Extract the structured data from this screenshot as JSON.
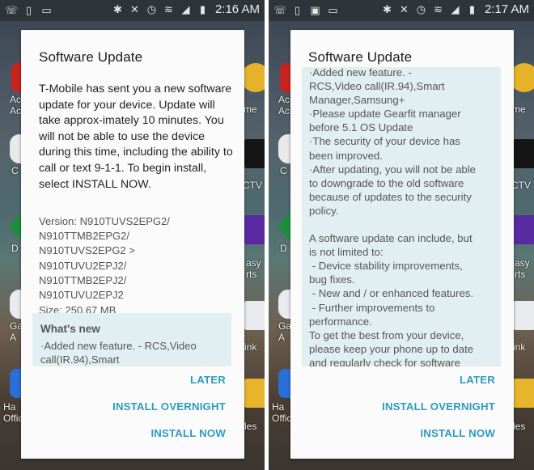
{
  "screens": [
    {
      "status_bar": {
        "time": "2:16 AM",
        "left_icons": [
          "wifi-calling-icon",
          "device-update-icon",
          "voicemail-icon"
        ],
        "right_icons": [
          "bluetooth-icon",
          "mute-icon",
          "alarm-icon",
          "wifi-icon",
          "signal-icon",
          "battery-charging-icon"
        ]
      },
      "background_apps_left": [
        {
          "label": "Ac\nAc",
          "color": "#c8231f"
        },
        {
          "label": "C",
          "color": "#e9e9e9"
        },
        {
          "label": "D",
          "color": "#1e8e3e"
        },
        {
          "label": "Ga\nA",
          "color": "#e8eaee"
        },
        {
          "label": "Ha\nOffic",
          "color": "#2a6fd6"
        }
      ],
      "background_apps_right": [
        {
          "label": "me",
          "color": "#e4b32a"
        },
        {
          "label": "CTV",
          "color": "#151515"
        },
        {
          "label": "asy\nrts",
          "color": "#5a2aa0"
        },
        {
          "label": "ink",
          "color": "#e8eaee"
        },
        {
          "label": "les",
          "color": "#e7b52b"
        }
      ],
      "dialog": {
        "title": "Software Update",
        "intro": "T-Mobile has sent you a new software update for your device. Update will take approx-imately 10 minutes. You will not be able to use the device during this time, including the ability to call or text 9-1-1. To begin install, select INSTALL NOW.",
        "version_lines": [
          "Version: N910TUVS2EPG2/",
          "N910TTMB2EPG2/",
          "N910TUVS2EPG2 >",
          "N910TUVU2EPJ2/",
          "N910TTMB2EPJ2/",
          "N910TUVU2EPJ2"
        ],
        "size": "Size: 250.67 MB",
        "whats_new_title": "What's new",
        "whats_new_text": "·Added new feature. - RCS,Video call(IR.94),Smart",
        "buttons": {
          "later": "LATER",
          "install_overnight": "INSTALL OVERNIGHT",
          "install_now": "INSTALL NOW"
        }
      }
    },
    {
      "status_bar": {
        "time": "2:17 AM",
        "left_icons": [
          "wifi-calling-icon",
          "device-update-icon",
          "image-icon",
          "voicemail-icon"
        ],
        "right_icons": [
          "bluetooth-icon",
          "mute-icon",
          "alarm-icon",
          "wifi-icon",
          "signal-icon",
          "battery-icon"
        ]
      },
      "dialog": {
        "title": "Software Update",
        "scroll_lines": [
          "·Added new feature. -",
          "RCS,Video call(IR.94),Smart",
          "Manager,Samsung+",
          "·Please update Gearfit manager",
          "before 5.1 OS Update",
          "·The security of your device has",
          "been improved.",
          "·After updating, you will not be able",
          "to downgrade to the old software",
          "because of updates to the security",
          "policy.",
          "",
          "A software update can include, but",
          "is not limited to:",
          " - Device stability improvements,",
          "bug fixes.",
          " - New and / or enhanced features.",
          " - Further improvements to",
          "performance.",
          "To get the best from your device,",
          "please keep your phone up to date",
          "and regularly check for software"
        ],
        "buttons": {
          "later": "LATER",
          "install_overnight": "INSTALL OVERNIGHT",
          "install_now": "INSTALL NOW"
        }
      }
    }
  ],
  "colors": {
    "accent": "#2e9bbf",
    "whats_new_bg": "#e1eff3",
    "status_bar": "#2f343b"
  }
}
